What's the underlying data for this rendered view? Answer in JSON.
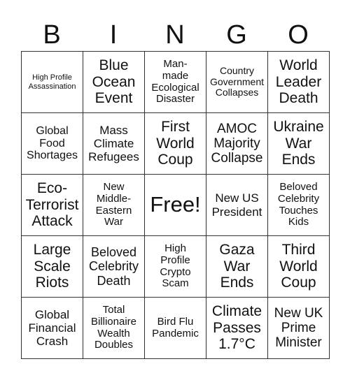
{
  "header": [
    "B",
    "I",
    "N",
    "G",
    "O"
  ],
  "cells": [
    [
      "High Profile\nAssassination",
      "Blue\nOcean\nEvent",
      "Man-\nmade\nEcological\nDisaster",
      "Country\nGovernment\nCollapses",
      "World\nLeader\nDeath"
    ],
    [
      "Global\nFood\nShortages",
      "Mass\nClimate\nRefugees",
      "First\nWorld\nCoup",
      "AMOC\nMajority\nCollapse",
      "Ukraine\nWar\nEnds"
    ],
    [
      "Eco-\nTerrorist\nAttack",
      "New\nMiddle-\nEastern\nWar",
      "Free!",
      "New US\nPresident",
      "Beloved\nCelebrity\nTouches\nKids"
    ],
    [
      "Large\nScale\nRiots",
      "Beloved\nCelebrity\nDeath",
      "High\nProfile\nCrypto\nScam",
      "Gaza\nWar\nEnds",
      "Third\nWorld\nCoup"
    ],
    [
      "Global\nFinancial\nCrash",
      "Total\nBillionaire\nWealth\nDoubles",
      "Bird Flu\nPandemic",
      "Climate\nPasses\n1.7°C",
      "New UK\nPrime\nMinister"
    ]
  ]
}
